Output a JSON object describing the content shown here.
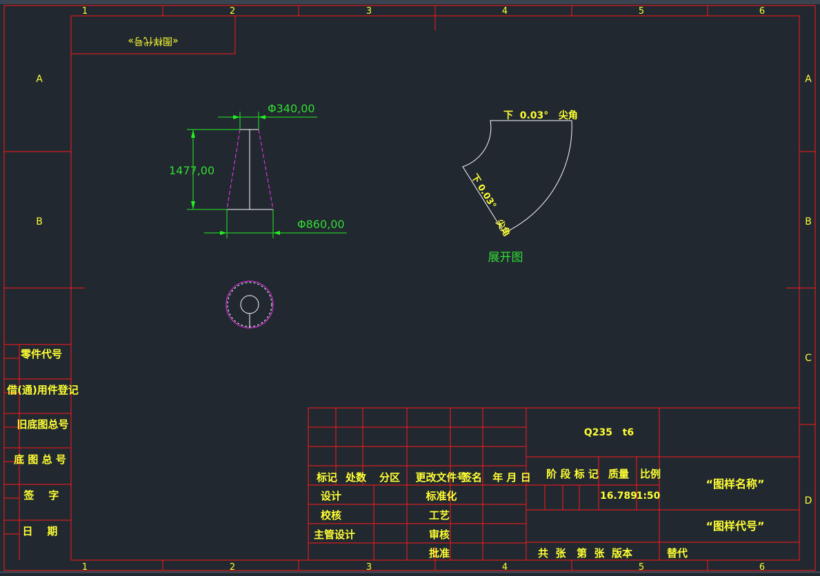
{
  "sheet": {
    "columns": [
      "1",
      "2",
      "3",
      "4",
      "5",
      "6"
    ],
    "rows": [
      "A",
      "B",
      "C",
      "D"
    ],
    "corner_label": "«图样代号»"
  },
  "left_block": [
    "零件代号",
    "借(通)用件登记",
    "旧底图总号",
    "底 图 总 号",
    "签    字",
    "日    期"
  ],
  "cone": {
    "top_diameter": "Φ340,00",
    "bottom_diameter": "Φ860,00",
    "height": "1477,00"
  },
  "development": {
    "top_label": "下  0.03°   尖角",
    "side_label_1": "下 0.03°",
    "side_label_2": "尖角",
    "caption": "展开图"
  },
  "title_block": {
    "headers": [
      "标记",
      "处数",
      "分区",
      "更改文件号",
      "签名",
      "年 月 日"
    ],
    "roles": [
      "设计",
      "校核",
      "主管设计"
    ],
    "roles2": [
      "标准化",
      "工艺",
      "审核",
      "批准"
    ],
    "material": "Q235   t6",
    "stage_label": "阶 段 标 记",
    "mass_label": "质量",
    "scale_label": "比例",
    "mass": "16.789",
    "scale": "1:50",
    "drawing_name": "“图样名称”",
    "drawing_code": "“图样代号”",
    "sheets_text": "共  张   第  张  版本",
    "replace": "替代"
  },
  "colors": {
    "background": "#212830",
    "frame": "#ff1a1a",
    "text": "#ffff33",
    "dimension": "#22ee22",
    "outline": "#ffffff",
    "hidden": "#ff33ff"
  }
}
